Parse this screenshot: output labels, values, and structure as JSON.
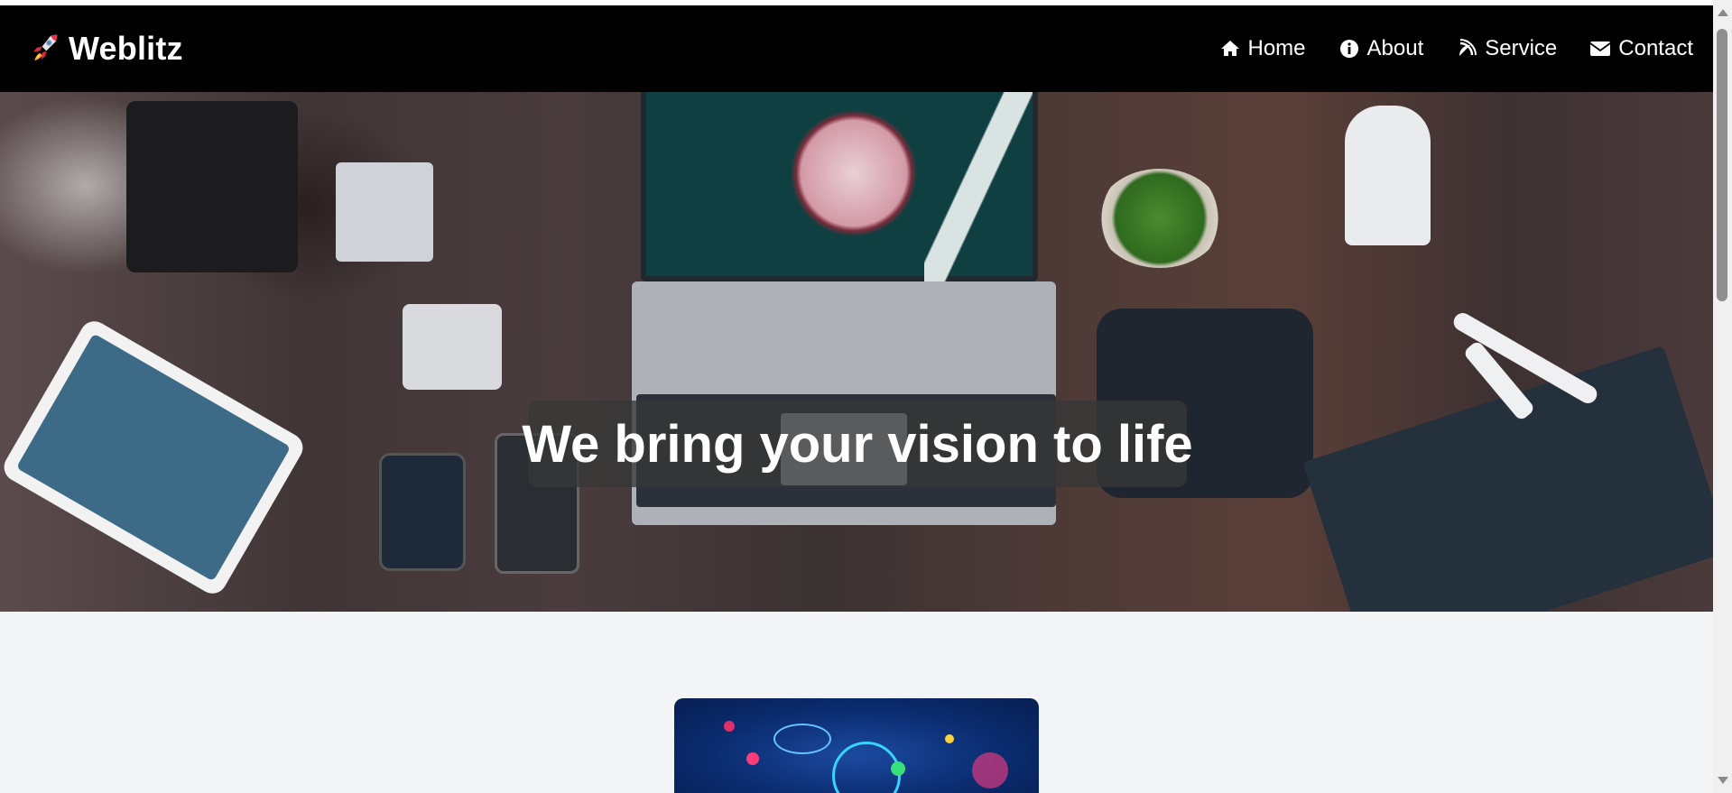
{
  "brand": {
    "name": "Weblitz",
    "icon": "rocket-icon"
  },
  "nav": {
    "items": [
      {
        "label": "Home",
        "icon": "home-icon"
      },
      {
        "label": "About",
        "icon": "info-icon"
      },
      {
        "label": "Service",
        "icon": "satellite-dish-icon"
      },
      {
        "label": "Contact",
        "icon": "envelope-icon"
      }
    ]
  },
  "hero": {
    "title": "We bring your vision to life"
  },
  "colors": {
    "navbar": "#000000",
    "page_bg": "#f3f4f6",
    "caption_bg": "#373737"
  }
}
